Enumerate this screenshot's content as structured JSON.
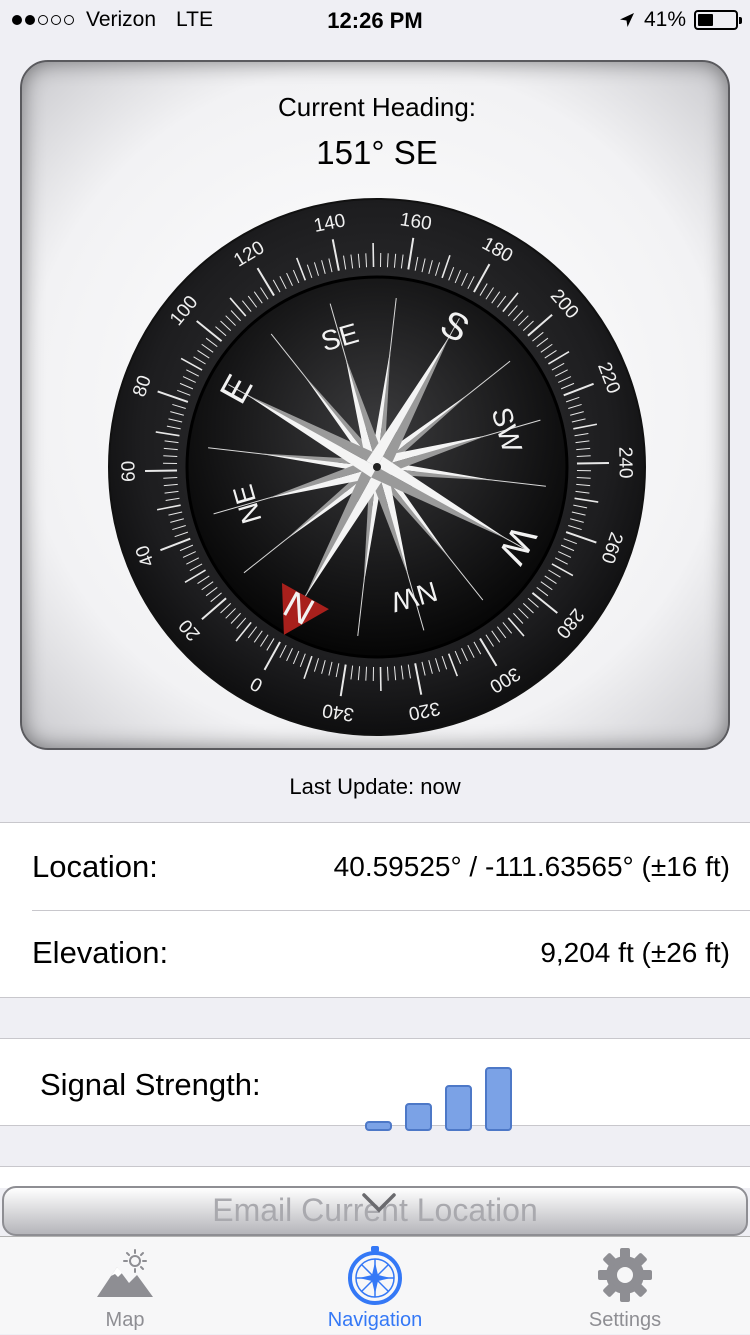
{
  "status_bar": {
    "carrier": "Verizon",
    "network": "LTE",
    "time": "12:26 PM",
    "battery": "41%",
    "battery_level": 0.41,
    "signal_dots_filled": 2,
    "signal_dots_total": 5
  },
  "compass": {
    "heading_label": "Current Heading:",
    "heading_value": "151° SE",
    "heading_degrees": 151,
    "dial_numbers": [
      "0",
      "20",
      "40",
      "60",
      "80",
      "100",
      "120",
      "140",
      "160",
      "180",
      "200",
      "220",
      "240",
      "260",
      "280",
      "300",
      "320",
      "340"
    ],
    "rose_labels": [
      "N",
      "NE",
      "E",
      "SE",
      "S",
      "SW",
      "W",
      "NW"
    ],
    "last_update": "Last Update: now"
  },
  "info": {
    "location_label": "Location:",
    "location_value": "40.59525° / -111.63565° (±16 ft)",
    "elevation_label": "Elevation:",
    "elevation_value": "9,204 ft (±26 ft)"
  },
  "signal": {
    "label": "Signal Strength:",
    "bars_total": 4,
    "bars_active": 4
  },
  "email_button": {
    "label": "Email Current Location"
  },
  "tabs": [
    {
      "label": "Map",
      "icon": "map-mountain-icon",
      "active": false
    },
    {
      "label": "Navigation",
      "icon": "compass-icon",
      "active": true
    },
    {
      "label": "Settings",
      "icon": "gear-icon",
      "active": false
    }
  ],
  "colors": {
    "accent": "#3478f6",
    "north_marker": "#a8201c",
    "signal_bar": "#7ba2e6"
  }
}
